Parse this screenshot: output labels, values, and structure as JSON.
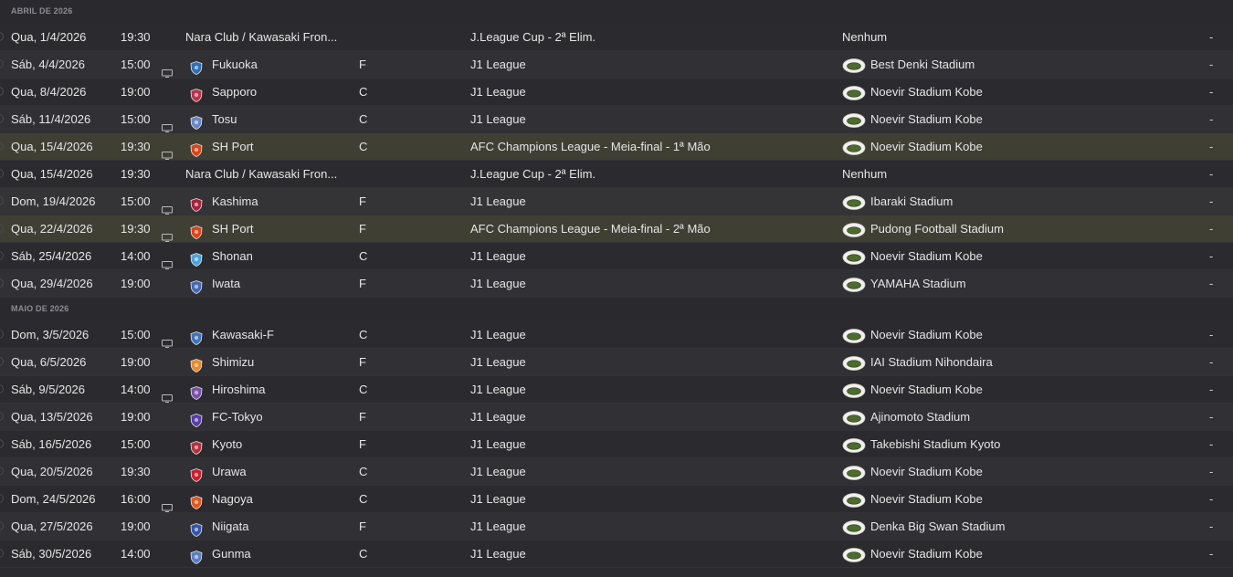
{
  "months": [
    {
      "label": "ABRIL DE 2026",
      "fixtures": [
        {
          "date": "Qua, 1/4/2026",
          "time": "19:30",
          "tv": false,
          "badge": "",
          "opponent": "Nara Club / Kawasaki Fron...",
          "venue": "",
          "competition": "J.League Cup - 2ª Elim.",
          "stadium": "Nenhum",
          "stadium_icon": false,
          "result": "-",
          "style": "normal"
        },
        {
          "date": "Sáb, 4/4/2026",
          "time": "15:00",
          "tv": true,
          "badge": "#2f6fb0",
          "opponent": "Fukuoka",
          "venue": "F",
          "competition": "J1 League",
          "stadium": "Best Denki Stadium",
          "stadium_icon": true,
          "result": "-",
          "style": "alt"
        },
        {
          "date": "Qua, 8/4/2026",
          "time": "19:00",
          "tv": false,
          "badge": "#b8334a",
          "opponent": "Sapporo",
          "venue": "C",
          "competition": "J1 League",
          "stadium": "Noevir Stadium Kobe",
          "stadium_icon": true,
          "result": "-",
          "style": "normal"
        },
        {
          "date": "Sáb, 11/4/2026",
          "time": "15:00",
          "tv": true,
          "badge": "#6a86c4",
          "opponent": "Tosu",
          "venue": "C",
          "competition": "J1 League",
          "stadium": "Noevir Stadium Kobe",
          "stadium_icon": true,
          "result": "-",
          "style": "alt"
        },
        {
          "date": "Qua, 15/4/2026",
          "time": "19:30",
          "tv": true,
          "badge": "#d9441c",
          "opponent": "SH Port",
          "venue": "C",
          "competition": "AFC Champions League - Meia-final - 1ª Mão",
          "stadium": "Noevir Stadium Kobe",
          "stadium_icon": true,
          "result": "-",
          "style": "hl"
        },
        {
          "date": "Qua, 15/4/2026",
          "time": "19:30",
          "tv": false,
          "badge": "",
          "opponent": "Nara Club / Kawasaki Fron...",
          "venue": "",
          "competition": "J.League Cup - 2ª Elim.",
          "stadium": "Nenhum",
          "stadium_icon": false,
          "result": "-",
          "style": "normal"
        },
        {
          "date": "Dom, 19/4/2026",
          "time": "15:00",
          "tv": true,
          "badge": "#a5223a",
          "opponent": "Kashima",
          "venue": "F",
          "competition": "J1 League",
          "stadium": "Ibaraki Stadium",
          "stadium_icon": true,
          "result": "-",
          "style": "cont"
        },
        {
          "date": "Qua, 22/4/2026",
          "time": "19:30",
          "tv": true,
          "badge": "#d9441c",
          "opponent": "SH Port",
          "venue": "F",
          "competition": "AFC Champions League - Meia-final - 2ª Mão",
          "stadium": "Pudong Football Stadium",
          "stadium_icon": true,
          "result": "-",
          "style": "hl"
        },
        {
          "date": "Sáb, 25/4/2026",
          "time": "14:00",
          "tv": true,
          "badge": "#4fa3d9",
          "opponent": "Shonan",
          "venue": "C",
          "competition": "J1 League",
          "stadium": "Noevir Stadium Kobe",
          "stadium_icon": true,
          "result": "-",
          "style": "normal"
        },
        {
          "date": "Qua, 29/4/2026",
          "time": "19:00",
          "tv": false,
          "badge": "#4668b5",
          "opponent": "Iwata",
          "venue": "F",
          "competition": "J1 League",
          "stadium": "YAMAHA Stadium",
          "stadium_icon": true,
          "result": "-",
          "style": "alt"
        }
      ]
    },
    {
      "label": "MAIO DE 2026",
      "fixtures": [
        {
          "date": "Dom, 3/5/2026",
          "time": "15:00",
          "tv": true,
          "badge": "#3f74b8",
          "opponent": "Kawasaki-F",
          "venue": "C",
          "competition": "J1 League",
          "stadium": "Noevir Stadium Kobe",
          "stadium_icon": true,
          "result": "-",
          "style": "normal"
        },
        {
          "date": "Qua, 6/5/2026",
          "time": "19:00",
          "tv": false,
          "badge": "#e88a2a",
          "opponent": "Shimizu",
          "venue": "F",
          "competition": "J1 League",
          "stadium": "IAI Stadium Nihondaira",
          "stadium_icon": true,
          "result": "-",
          "style": "alt"
        },
        {
          "date": "Sáb, 9/5/2026",
          "time": "14:00",
          "tv": true,
          "badge": "#7a4fa8",
          "opponent": "Hiroshima",
          "venue": "C",
          "competition": "J1 League",
          "stadium": "Noevir Stadium Kobe",
          "stadium_icon": true,
          "result": "-",
          "style": "normal"
        },
        {
          "date": "Qua, 13/5/2026",
          "time": "19:00",
          "tv": false,
          "badge": "#5b3aa6",
          "opponent": "FC-Tokyo",
          "venue": "F",
          "competition": "J1 League",
          "stadium": "Ajinomoto Stadium",
          "stadium_icon": true,
          "result": "-",
          "style": "alt"
        },
        {
          "date": "Sáb, 16/5/2026",
          "time": "15:00",
          "tv": false,
          "badge": "#b5303e",
          "opponent": "Kyoto",
          "venue": "F",
          "competition": "J1 League",
          "stadium": "Takebishi Stadium Kyoto",
          "stadium_icon": true,
          "result": "-",
          "style": "normal"
        },
        {
          "date": "Qua, 20/5/2026",
          "time": "19:30",
          "tv": false,
          "badge": "#c8202e",
          "opponent": "Urawa",
          "venue": "C",
          "competition": "J1 League",
          "stadium": "Noevir Stadium Kobe",
          "stadium_icon": true,
          "result": "-",
          "style": "alt"
        },
        {
          "date": "Dom, 24/5/2026",
          "time": "16:00",
          "tv": true,
          "badge": "#e0561e",
          "opponent": "Nagoya",
          "venue": "C",
          "competition": "J1 League",
          "stadium": "Noevir Stadium Kobe",
          "stadium_icon": true,
          "result": "-",
          "style": "normal"
        },
        {
          "date": "Qua, 27/5/2026",
          "time": "19:00",
          "tv": false,
          "badge": "#3556a8",
          "opponent": "Niigata",
          "venue": "F",
          "competition": "J1 League",
          "stadium": "Denka Big Swan Stadium",
          "stadium_icon": true,
          "result": "-",
          "style": "alt"
        },
        {
          "date": "Sáb, 30/5/2026",
          "time": "14:00",
          "tv": false,
          "badge": "#5a7fc0",
          "opponent": "Gunma",
          "venue": "C",
          "competition": "J1 League",
          "stadium": "Noevir Stadium Kobe",
          "stadium_icon": true,
          "result": "-",
          "style": "normal"
        }
      ]
    }
  ],
  "colors": {
    "background": "#2b2b2f",
    "row_alt": "#303035",
    "row_highlight": "#3f3f34",
    "header_text": "#8b8b92",
    "text": "#e6e6e6"
  },
  "icons": {
    "tv": "tv-icon",
    "badge": "club-badge-icon",
    "stadium": "stadium-icon",
    "check": "check-circle-icon"
  }
}
